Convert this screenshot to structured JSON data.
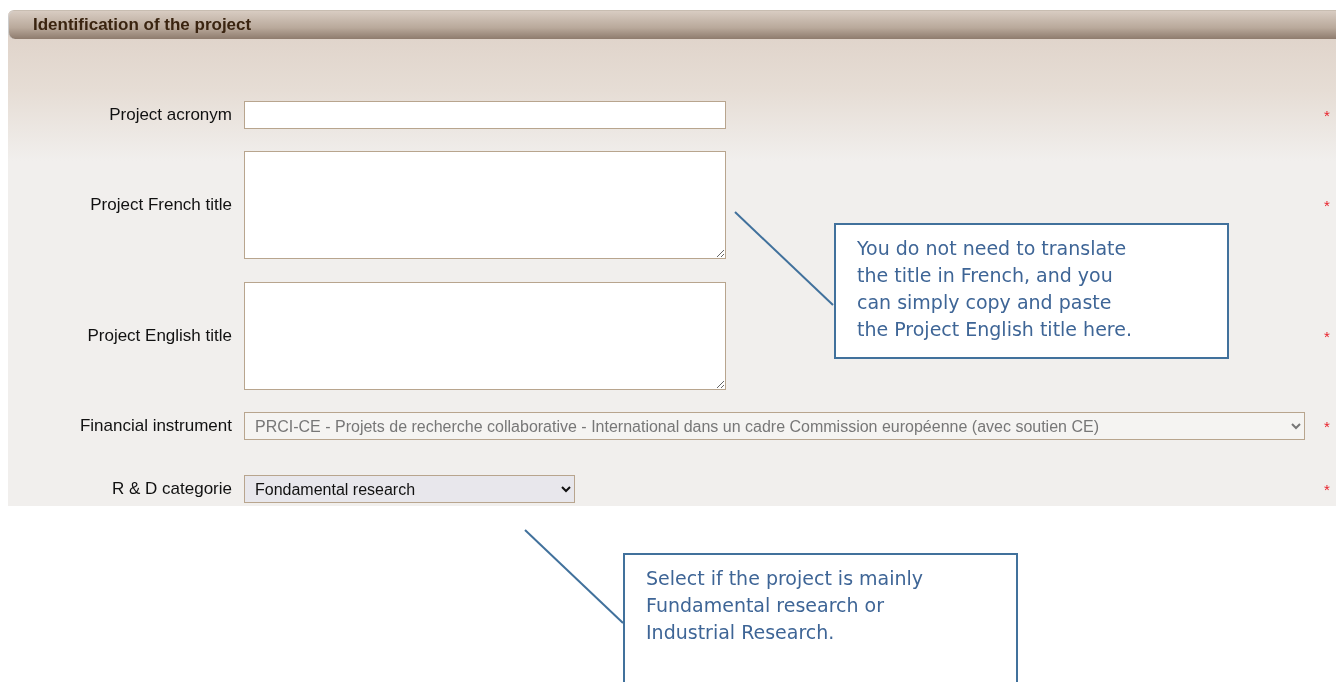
{
  "section": {
    "title": "Identification of the project"
  },
  "fields": [
    {
      "label": "Project acronym",
      "kind": "text",
      "required_mark": "*"
    },
    {
      "label": "Project French title",
      "kind": "textarea",
      "required_mark": "*"
    },
    {
      "label": "Project English title",
      "kind": "textarea",
      "required_mark": "*"
    },
    {
      "label": "Financial instrument",
      "kind": "select",
      "value": "PRCI-CE - Projets de recherche collaborative - International dans un cadre Commission européenne (avec soutien CE)",
      "disabled": true,
      "required_mark": "*"
    },
    {
      "label": "R & D categorie",
      "kind": "select",
      "value": "Fondamental research",
      "disabled": false,
      "required_mark": "*"
    }
  ],
  "callouts": [
    {
      "text": "You do not need to translate the title in French, and you can simply copy and paste the Project English title here."
    },
    {
      "text": "Select if the project is mainly Fundamental research or Industrial Research."
    }
  ]
}
